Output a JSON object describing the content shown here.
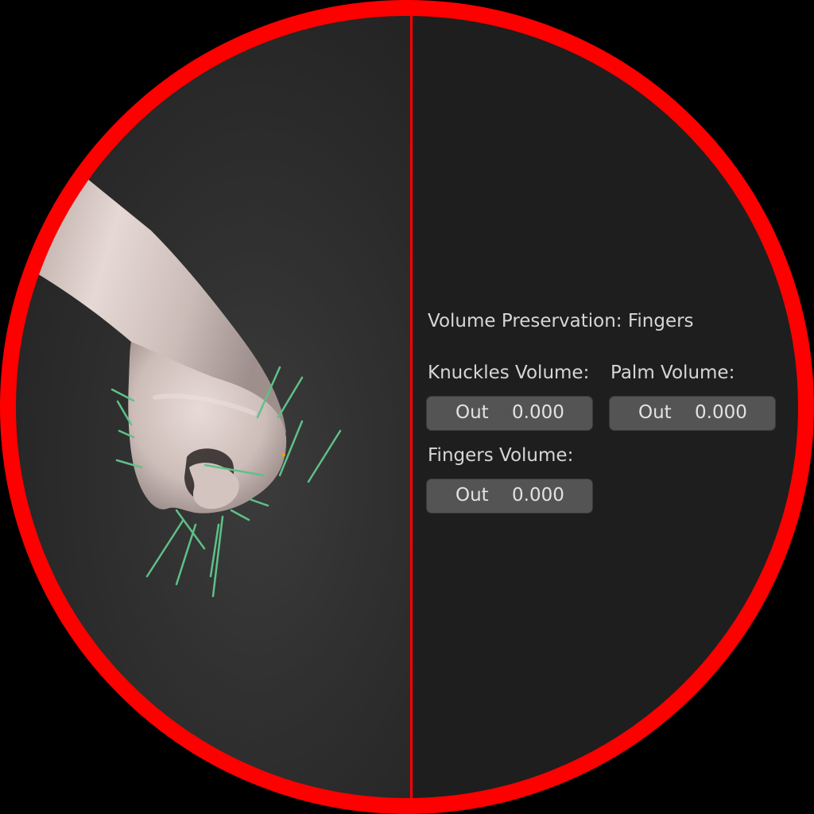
{
  "panel": {
    "title": "Volume Preservation: Fingers",
    "fields": [
      {
        "label": "Knuckles Volume:",
        "name": "Out",
        "value": "0.000"
      },
      {
        "label": "Palm Volume:",
        "name": "Out",
        "value": "0.000"
      },
      {
        "label": "Fingers Volume:",
        "name": "Out",
        "value": "0.000"
      }
    ]
  },
  "colors": {
    "frame_ring": "#ff0000",
    "viewport_bg": "#303030",
    "panel_bg": "#1e1e1e",
    "field_bg": "#545454",
    "text": "#d6d6d6",
    "bone_lines": "#5fc089",
    "skin": "#d9c9c5"
  }
}
